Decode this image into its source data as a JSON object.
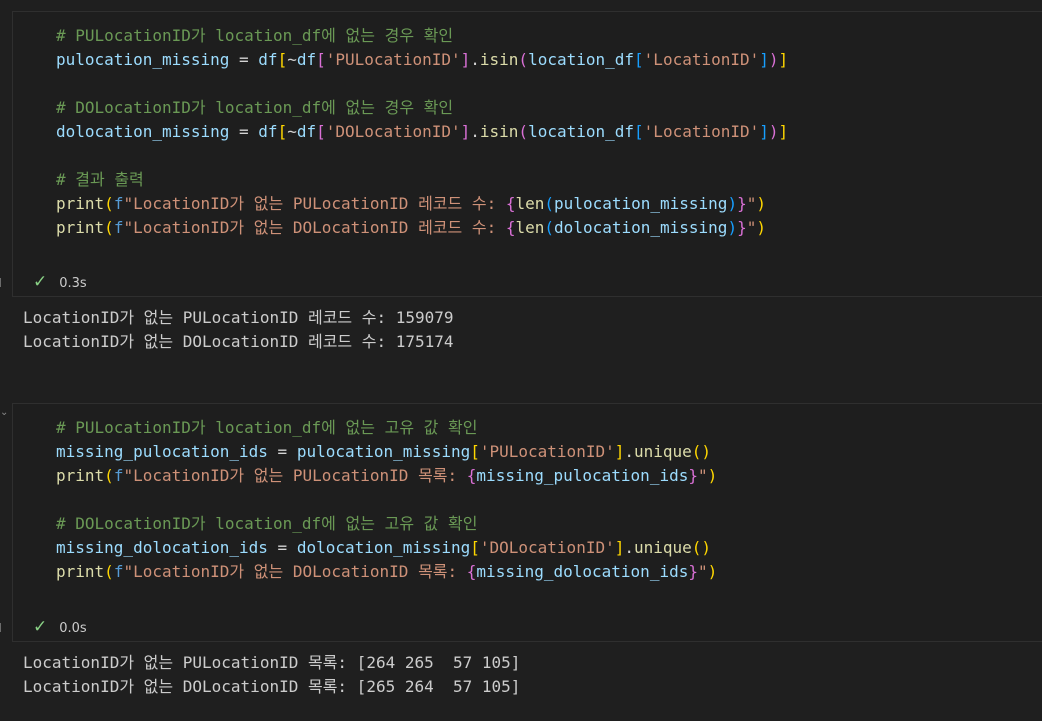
{
  "cells": [
    {
      "code_lines": [
        [
          {
            "t": "# PULocationID가 location_df에 없는 경우 확인",
            "c": "c"
          }
        ],
        [
          {
            "t": "pulocation_missing",
            "c": "v"
          },
          {
            "t": " = ",
            "c": "o"
          },
          {
            "t": "df",
            "c": "v"
          },
          {
            "t": "[",
            "c": "b1"
          },
          {
            "t": "~",
            "c": "o"
          },
          {
            "t": "df",
            "c": "v"
          },
          {
            "t": "[",
            "c": "b2"
          },
          {
            "t": "'PULocationID'",
            "c": "s"
          },
          {
            "t": "]",
            "c": "b2"
          },
          {
            "t": ".",
            "c": "o"
          },
          {
            "t": "isin",
            "c": "f"
          },
          {
            "t": "(",
            "c": "b2"
          },
          {
            "t": "location_df",
            "c": "v"
          },
          {
            "t": "[",
            "c": "b3"
          },
          {
            "t": "'LocationID'",
            "c": "s"
          },
          {
            "t": "]",
            "c": "b3"
          },
          {
            "t": ")",
            "c": "b2"
          },
          {
            "t": "]",
            "c": "b1"
          }
        ],
        [],
        [
          {
            "t": "# DOLocationID가 location_df에 없는 경우 확인",
            "c": "c"
          }
        ],
        [
          {
            "t": "dolocation_missing",
            "c": "v"
          },
          {
            "t": " = ",
            "c": "o"
          },
          {
            "t": "df",
            "c": "v"
          },
          {
            "t": "[",
            "c": "b1"
          },
          {
            "t": "~",
            "c": "o"
          },
          {
            "t": "df",
            "c": "v"
          },
          {
            "t": "[",
            "c": "b2"
          },
          {
            "t": "'DOLocationID'",
            "c": "s"
          },
          {
            "t": "]",
            "c": "b2"
          },
          {
            "t": ".",
            "c": "o"
          },
          {
            "t": "isin",
            "c": "f"
          },
          {
            "t": "(",
            "c": "b2"
          },
          {
            "t": "location_df",
            "c": "v"
          },
          {
            "t": "[",
            "c": "b3"
          },
          {
            "t": "'LocationID'",
            "c": "s"
          },
          {
            "t": "]",
            "c": "b3"
          },
          {
            "t": ")",
            "c": "b2"
          },
          {
            "t": "]",
            "c": "b1"
          }
        ],
        [],
        [
          {
            "t": "# 결과 출력",
            "c": "c"
          }
        ],
        [
          {
            "t": "print",
            "c": "f"
          },
          {
            "t": "(",
            "c": "b1"
          },
          {
            "t": "f",
            "c": "k"
          },
          {
            "t": "\"LocationID가 없는 PULocationID 레코드 수: ",
            "c": "s"
          },
          {
            "t": "{",
            "c": "b2"
          },
          {
            "t": "len",
            "c": "f"
          },
          {
            "t": "(",
            "c": "b3"
          },
          {
            "t": "pulocation_missing",
            "c": "v"
          },
          {
            "t": ")",
            "c": "b3"
          },
          {
            "t": "}",
            "c": "b2"
          },
          {
            "t": "\"",
            "c": "s"
          },
          {
            "t": ")",
            "c": "b1"
          }
        ],
        [
          {
            "t": "print",
            "c": "f"
          },
          {
            "t": "(",
            "c": "b1"
          },
          {
            "t": "f",
            "c": "k"
          },
          {
            "t": "\"LocationID가 없는 DOLocationID 레코드 수: ",
            "c": "s"
          },
          {
            "t": "{",
            "c": "b2"
          },
          {
            "t": "len",
            "c": "f"
          },
          {
            "t": "(",
            "c": "b3"
          },
          {
            "t": "dolocation_missing",
            "c": "v"
          },
          {
            "t": ")",
            "c": "b3"
          },
          {
            "t": "}",
            "c": "b2"
          },
          {
            "t": "\"",
            "c": "s"
          },
          {
            "t": ")",
            "c": "b1"
          }
        ]
      ],
      "status": {
        "check": "✓",
        "time": "0.3s"
      },
      "output": [
        "LocationID가 없는 PULocationID 레코드 수: 159079",
        "LocationID가 없는 DOLocationID 레코드 수: 175174"
      ]
    },
    {
      "code_lines": [
        [
          {
            "t": "# PULocationID가 location_df에 없는 고유 값 확인",
            "c": "c"
          }
        ],
        [
          {
            "t": "missing_pulocation_ids",
            "c": "v"
          },
          {
            "t": " = ",
            "c": "o"
          },
          {
            "t": "pulocation_missing",
            "c": "v"
          },
          {
            "t": "[",
            "c": "b1"
          },
          {
            "t": "'PULocationID'",
            "c": "s"
          },
          {
            "t": "]",
            "c": "b1"
          },
          {
            "t": ".",
            "c": "o"
          },
          {
            "t": "unique",
            "c": "f"
          },
          {
            "t": "()",
            "c": "b1"
          }
        ],
        [
          {
            "t": "print",
            "c": "f"
          },
          {
            "t": "(",
            "c": "b1"
          },
          {
            "t": "f",
            "c": "k"
          },
          {
            "t": "\"LocationID가 없는 PULocationID 목록: ",
            "c": "s"
          },
          {
            "t": "{",
            "c": "b2"
          },
          {
            "t": "missing_pulocation_ids",
            "c": "v"
          },
          {
            "t": "}",
            "c": "b2"
          },
          {
            "t": "\"",
            "c": "s"
          },
          {
            "t": ")",
            "c": "b1"
          }
        ],
        [],
        [
          {
            "t": "# DOLocationID가 location_df에 없는 고유 값 확인",
            "c": "c"
          }
        ],
        [
          {
            "t": "missing_dolocation_ids",
            "c": "v"
          },
          {
            "t": " = ",
            "c": "o"
          },
          {
            "t": "dolocation_missing",
            "c": "v"
          },
          {
            "t": "[",
            "c": "b1"
          },
          {
            "t": "'DOLocationID'",
            "c": "s"
          },
          {
            "t": "]",
            "c": "b1"
          },
          {
            "t": ".",
            "c": "o"
          },
          {
            "t": "unique",
            "c": "f"
          },
          {
            "t": "()",
            "c": "b1"
          }
        ],
        [
          {
            "t": "print",
            "c": "f"
          },
          {
            "t": "(",
            "c": "b1"
          },
          {
            "t": "f",
            "c": "k"
          },
          {
            "t": "\"LocationID가 없는 DOLocationID 목록: ",
            "c": "s"
          },
          {
            "t": "{",
            "c": "b2"
          },
          {
            "t": "missing_dolocation_ids",
            "c": "v"
          },
          {
            "t": "}",
            "c": "b2"
          },
          {
            "t": "\"",
            "c": "s"
          },
          {
            "t": ")",
            "c": "b1"
          }
        ]
      ],
      "status": {
        "check": "✓",
        "time": "0.0s"
      },
      "output": [
        "LocationID가 없는 PULocationID 목록: [264 265  57 105]",
        "LocationID가 없는 DOLocationID 목록: [265 264  57 105]"
      ]
    }
  ]
}
